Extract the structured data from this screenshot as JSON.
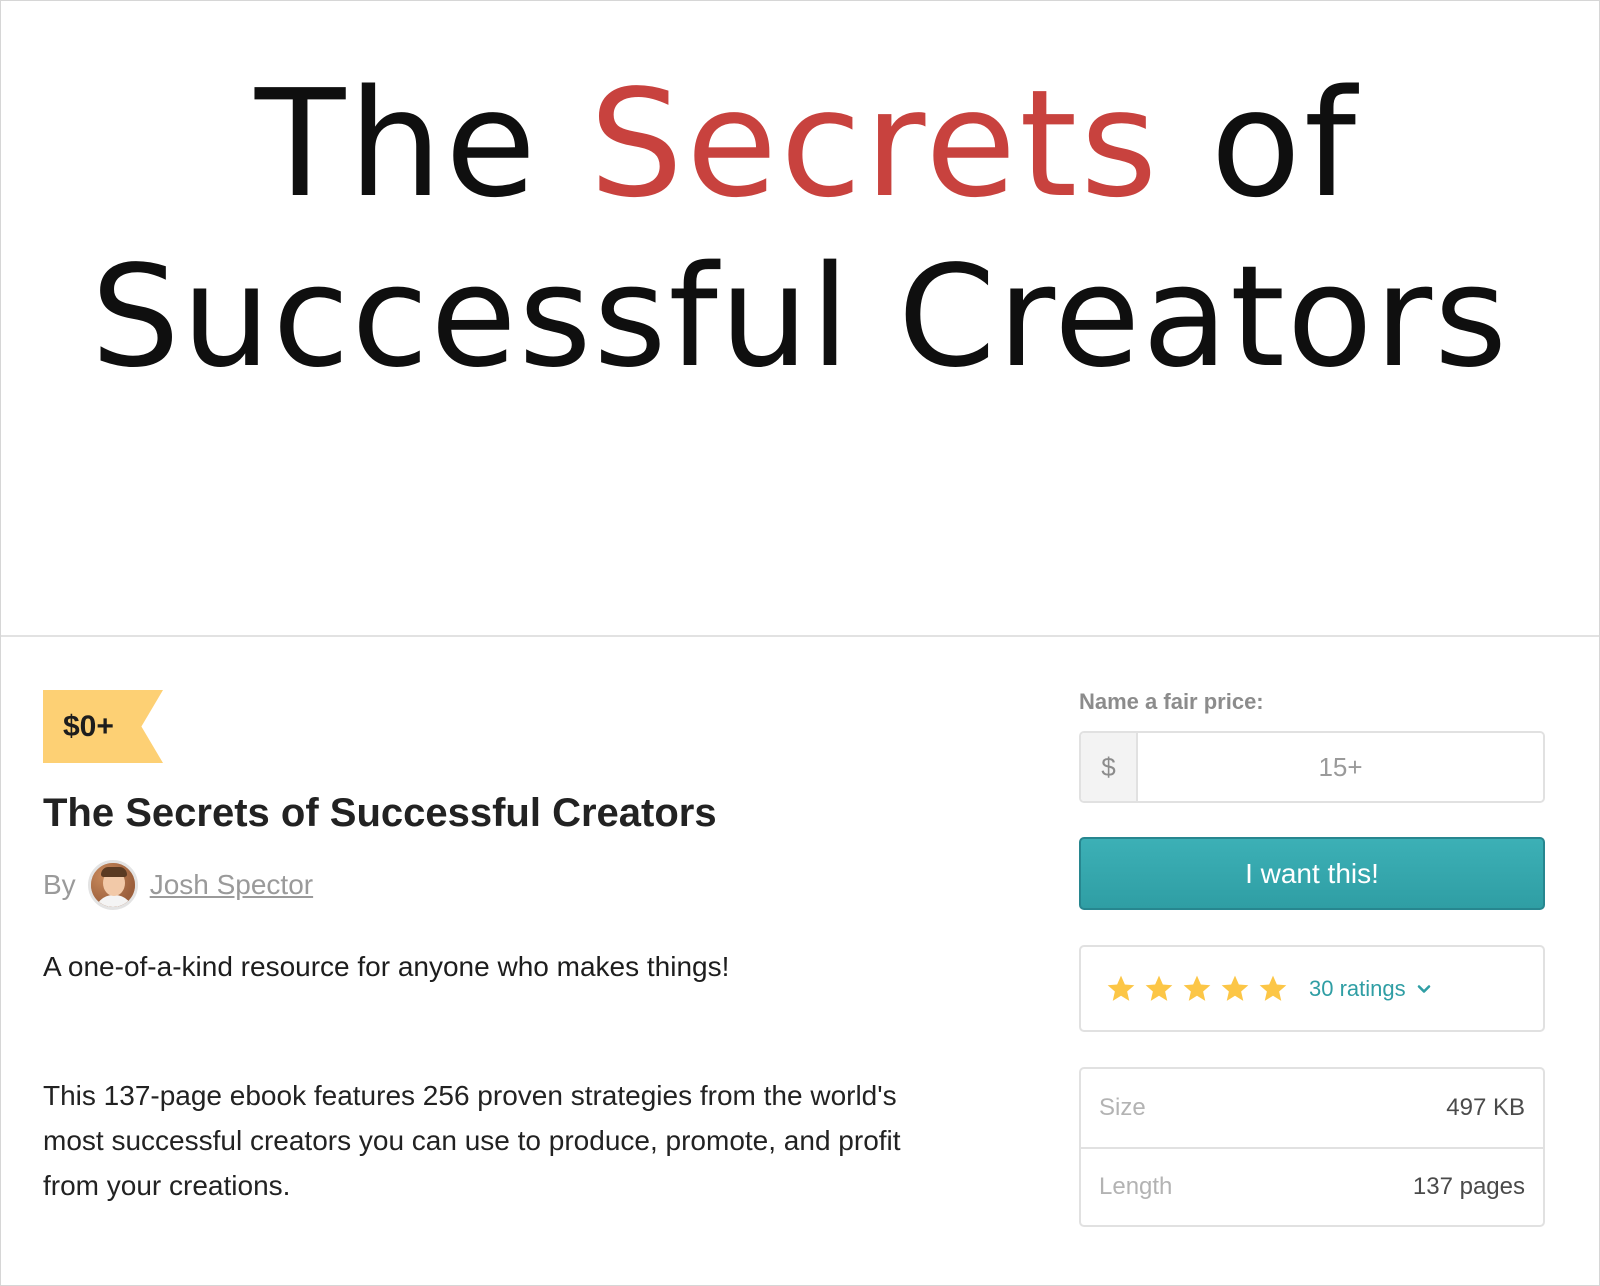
{
  "cover": {
    "line1_pre": "The ",
    "line1_accent": "Secrets",
    "line1_post": " of",
    "line2": "Successful Creators",
    "accent_color": "#c8423e"
  },
  "product": {
    "price_badge": "$0+",
    "title": "The Secrets of Successful Creators",
    "by_label": "By",
    "author": "Josh Spector",
    "tagline": "A one-of-a-kind resource for anyone who makes things!",
    "description": "This 137-page ebook features 256 proven strategies from the world's most successful creators you can use to produce, promote, and profit from your creations."
  },
  "purchase": {
    "price_label": "Name a fair price:",
    "currency_symbol": "$",
    "price_placeholder": "15+",
    "button_label": "I want this!",
    "button_color": "#34a7ad"
  },
  "ratings": {
    "stars": 5,
    "star_color": "#fcc646",
    "count_label": "30 ratings",
    "link_color": "#2f9ea4"
  },
  "details": {
    "size_label": "Size",
    "size_value": "497 KB",
    "length_label": "Length",
    "length_value": "137 pages"
  },
  "badge_color": "#fdd074"
}
